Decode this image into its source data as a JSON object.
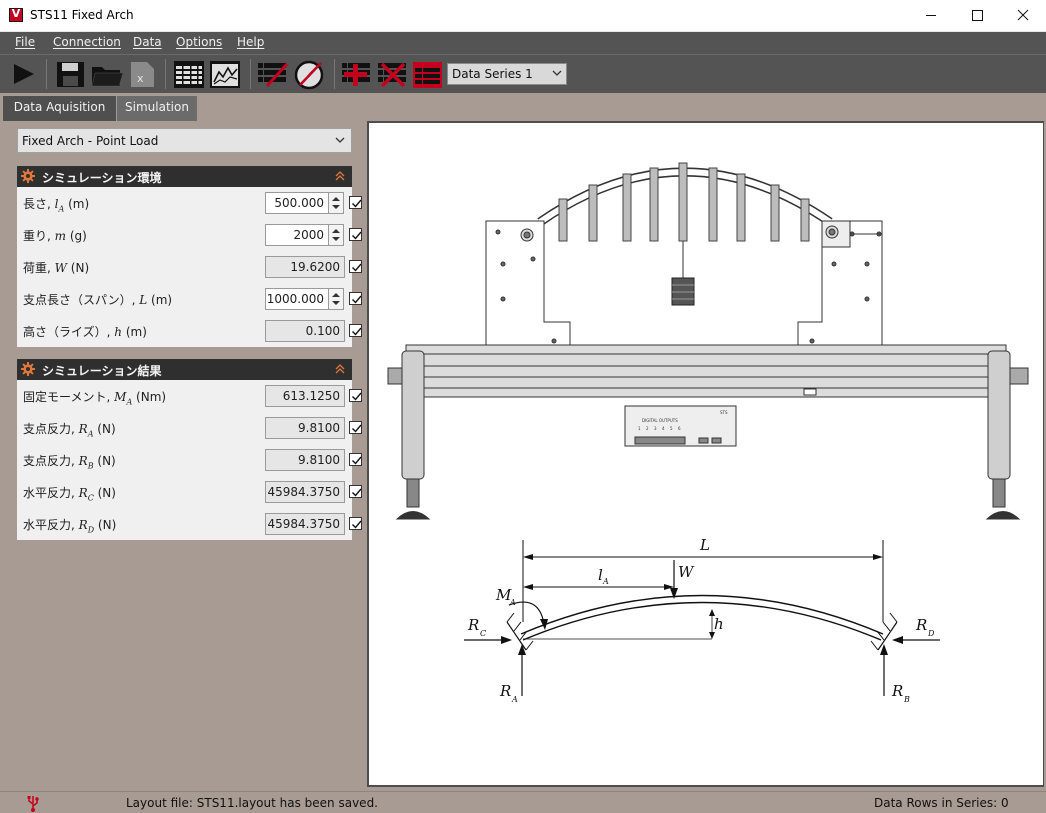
{
  "window": {
    "title": "STS11 Fixed Arch",
    "icon_letter": "V"
  },
  "menu": [
    "File",
    "Connection",
    "Data",
    "Options",
    "Help"
  ],
  "toolbar": {
    "icons": [
      "play-icon",
      "save-icon",
      "open-folder-icon",
      "excel-export-icon",
      "table-icon",
      "graph-icon",
      "edit-table-icon",
      "gauge-icon",
      "add-series-icon",
      "delete-series-icon",
      "series-table-icon"
    ],
    "series_selected": "Data Series 1"
  },
  "tabs": [
    {
      "label": "Data Aquisition",
      "active": false
    },
    {
      "label": "Simulation",
      "active": true
    }
  ],
  "model_select": "Fixed Arch - Point Load",
  "env_group": {
    "title": "シミュレーション環境",
    "rows": [
      {
        "label": "長さ, ",
        "sym": "lA",
        "unit": " (m)",
        "value": "500.000",
        "editable": true,
        "spinner": true
      },
      {
        "label": "重り, ",
        "sym": "m",
        "unit": " (g)",
        "value": "2000",
        "editable": true,
        "spinner": true
      },
      {
        "label": "荷重, ",
        "sym": "W",
        "unit": " (N)",
        "value": "19.6200",
        "editable": false,
        "spinner": false
      },
      {
        "label": "支点長さ（スパン）, ",
        "sym": "L",
        "unit": " (m)",
        "value": "1000.000",
        "editable": true,
        "spinner": true
      },
      {
        "label": "高さ（ライズ）, ",
        "sym": "h",
        "unit": " (m)",
        "value": "0.100",
        "editable": false,
        "spinner": false
      }
    ]
  },
  "result_group": {
    "title": "シミュレーション結果",
    "rows": [
      {
        "label": "固定モーメント, ",
        "sym": "MA",
        "unit": " (Nm)",
        "value": "613.1250"
      },
      {
        "label": "支点反力, ",
        "sym": "RA",
        "unit": " (N)",
        "value": "9.8100"
      },
      {
        "label": "支点反力, ",
        "sym": "RB",
        "unit": " (N)",
        "value": "9.8100"
      },
      {
        "label": "水平反力, ",
        "sym": "RC",
        "unit": " (N)",
        "value": "45984.3750"
      },
      {
        "label": "水平反力, ",
        "sym": "RD",
        "unit": " (N)",
        "value": "45984.3750"
      }
    ]
  },
  "diagram": {
    "device_panel": {
      "title": "DIGITAL OUTPUTS",
      "tag": "STS",
      "numbers": [
        "1",
        "2",
        "3",
        "4",
        "5",
        "6"
      ]
    },
    "labels": {
      "L": "L",
      "lA": "l",
      "lA_sub": "A",
      "W": "W",
      "MA": "M",
      "MA_sub": "A",
      "h": "h",
      "RC": "R",
      "RC_sub": "C",
      "RD": "R",
      "RD_sub": "D",
      "RA": "R",
      "RA_sub": "A",
      "RB": "R",
      "RB_sub": "B"
    }
  },
  "status": {
    "message": "Layout file: STS11.layout has been saved.",
    "rows": "Data Rows in Series: 0"
  },
  "colors": {
    "accent": "#c3001e",
    "menubar": "#545454",
    "panel": "#a89b93",
    "group_header": "#2f2f2f"
  }
}
